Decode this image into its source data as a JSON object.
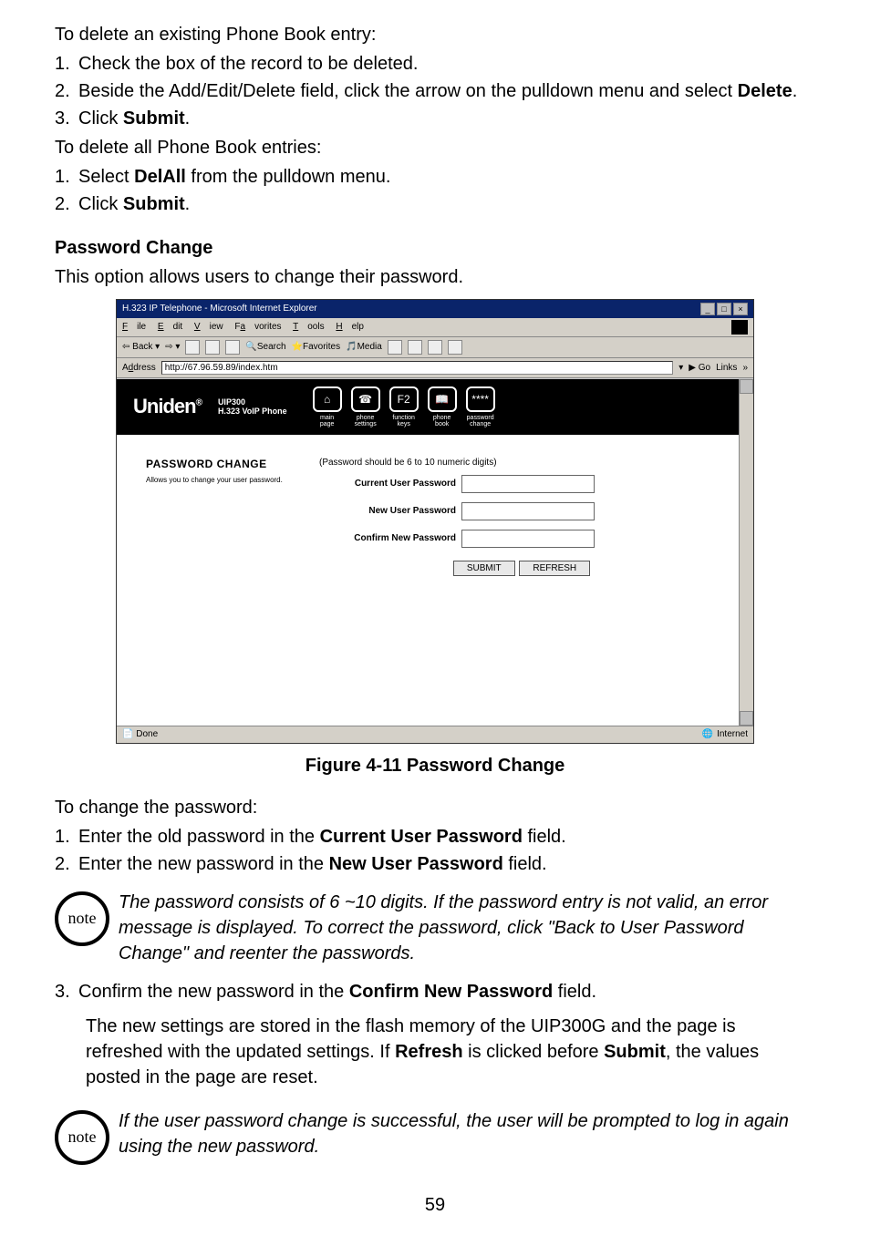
{
  "para1": "To delete an existing Phone Book entry:",
  "list1": [
    "Check the box of the record to be deleted.",
    "Beside the Add/Edit/Delete field, click the arrow on the pulldown menu and select ",
    "Click "
  ],
  "list1_bold": [
    "",
    "Delete",
    "Submit"
  ],
  "list1_tail": [
    "",
    ".",
    "."
  ],
  "para2": "To delete all Phone Book entries:",
  "list2_pre": [
    "Select ",
    "Click "
  ],
  "list2_bold": [
    "DelAll",
    "Submit"
  ],
  "list2_post": [
    " from the pulldown menu.",
    "."
  ],
  "heading1": "Password Change",
  "para3": "This option allows users to change their password.",
  "ie": {
    "title": "H.323 IP Telephone - Microsoft Internet Explorer",
    "menus": [
      "File",
      "Edit",
      "View",
      "Favorites",
      "Tools",
      "Help"
    ],
    "toolbar": [
      "Back",
      "Search",
      "Favorites",
      "Media"
    ],
    "addr_label": "Address",
    "url": "http://67.96.59.89/index.htm",
    "go": "Go",
    "links": "Links",
    "status_done": "Done",
    "status_zone": "Internet"
  },
  "uniden": {
    "brand": "Uniden",
    "model": "UIP300",
    "subtitle": "H.323 VoIP Phone",
    "nav": [
      {
        "icon": "⌂",
        "label": "main\npage"
      },
      {
        "icon": "☎",
        "label": "phone\nsettings"
      },
      {
        "icon": "F2",
        "label": "function\nkeys"
      },
      {
        "icon": "📖",
        "label": "phone\nbook"
      },
      {
        "icon": "****",
        "label": "password\nchange"
      }
    ]
  },
  "form": {
    "section_title": "PASSWORD CHANGE",
    "section_desc": "Allows you to change your user password.",
    "hint": "(Password should be 6 to 10 numeric digits)",
    "labels": {
      "current": "Current User Password",
      "new": "New User Password",
      "confirm": "Confirm New Password"
    },
    "submit": "SUBMIT",
    "refresh": "REFRESH"
  },
  "figure_caption": "Figure 4-11 Password Change",
  "para4": "To change the password:",
  "list3_pre": [
    "Enter the old password in the ",
    "Enter the new password in the "
  ],
  "list3_bold": [
    "Current User Password",
    "New User Password"
  ],
  "list3_post": [
    " field.",
    " field."
  ],
  "note1": "The password consists of 6 ~10 digits. If the password entry is not valid, an error message is displayed. To correct the password, click \"Back to User Password Change\" and reenter the passwords.",
  "list4_num": "3.",
  "list4_pre": "Confirm the new password in the ",
  "list4_bold": "Confirm New Password",
  "list4_post": " field.",
  "para5a": "The new settings are stored in the flash memory of the UIP300G and the page is refreshed with the updated settings. If ",
  "para5b": "Refresh",
  "para5c": " is clicked before ",
  "para5d": "Submit",
  "para5e": ", the values posted in the page are reset.",
  "note2": "If the user password change is successful, the user will be prompted to log in again using the new password.",
  "note_label": "note",
  "page_num": "59"
}
